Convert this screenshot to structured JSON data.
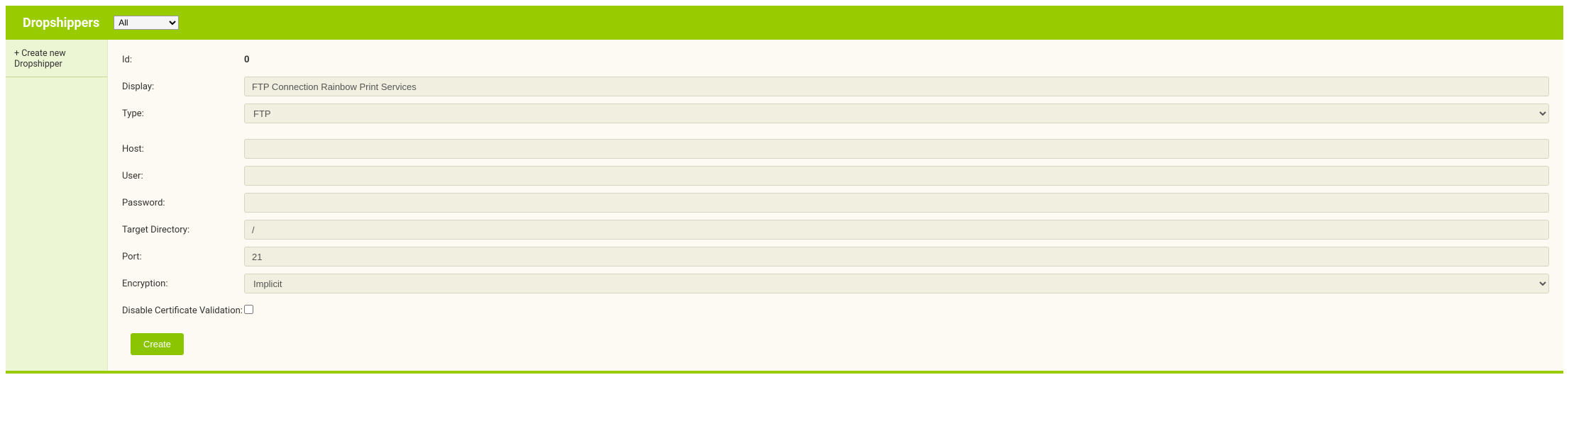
{
  "header": {
    "title": "Dropshippers",
    "filter_selected": "All",
    "filter_options": [
      "All"
    ]
  },
  "sidebar": {
    "create_label": "+ Create new Dropshipper"
  },
  "form": {
    "id_label": "Id:",
    "id_value": "0",
    "display_label": "Display:",
    "display_value": "FTP Connection Rainbow Print Services",
    "type_label": "Type:",
    "type_value": "FTP",
    "type_options": [
      "FTP"
    ],
    "host_label": "Host:",
    "host_value": "",
    "user_label": "User:",
    "user_value": "",
    "password_label": "Password:",
    "password_value": "",
    "target_dir_label": "Target Directory:",
    "target_dir_value": "/",
    "port_label": "Port:",
    "port_value": "21",
    "encryption_label": "Encryption:",
    "encryption_value": "Implicit",
    "encryption_options": [
      "Implicit"
    ],
    "disable_cert_label": "Disable Certificate Validation:",
    "disable_cert_checked": false,
    "create_button": "Create"
  }
}
